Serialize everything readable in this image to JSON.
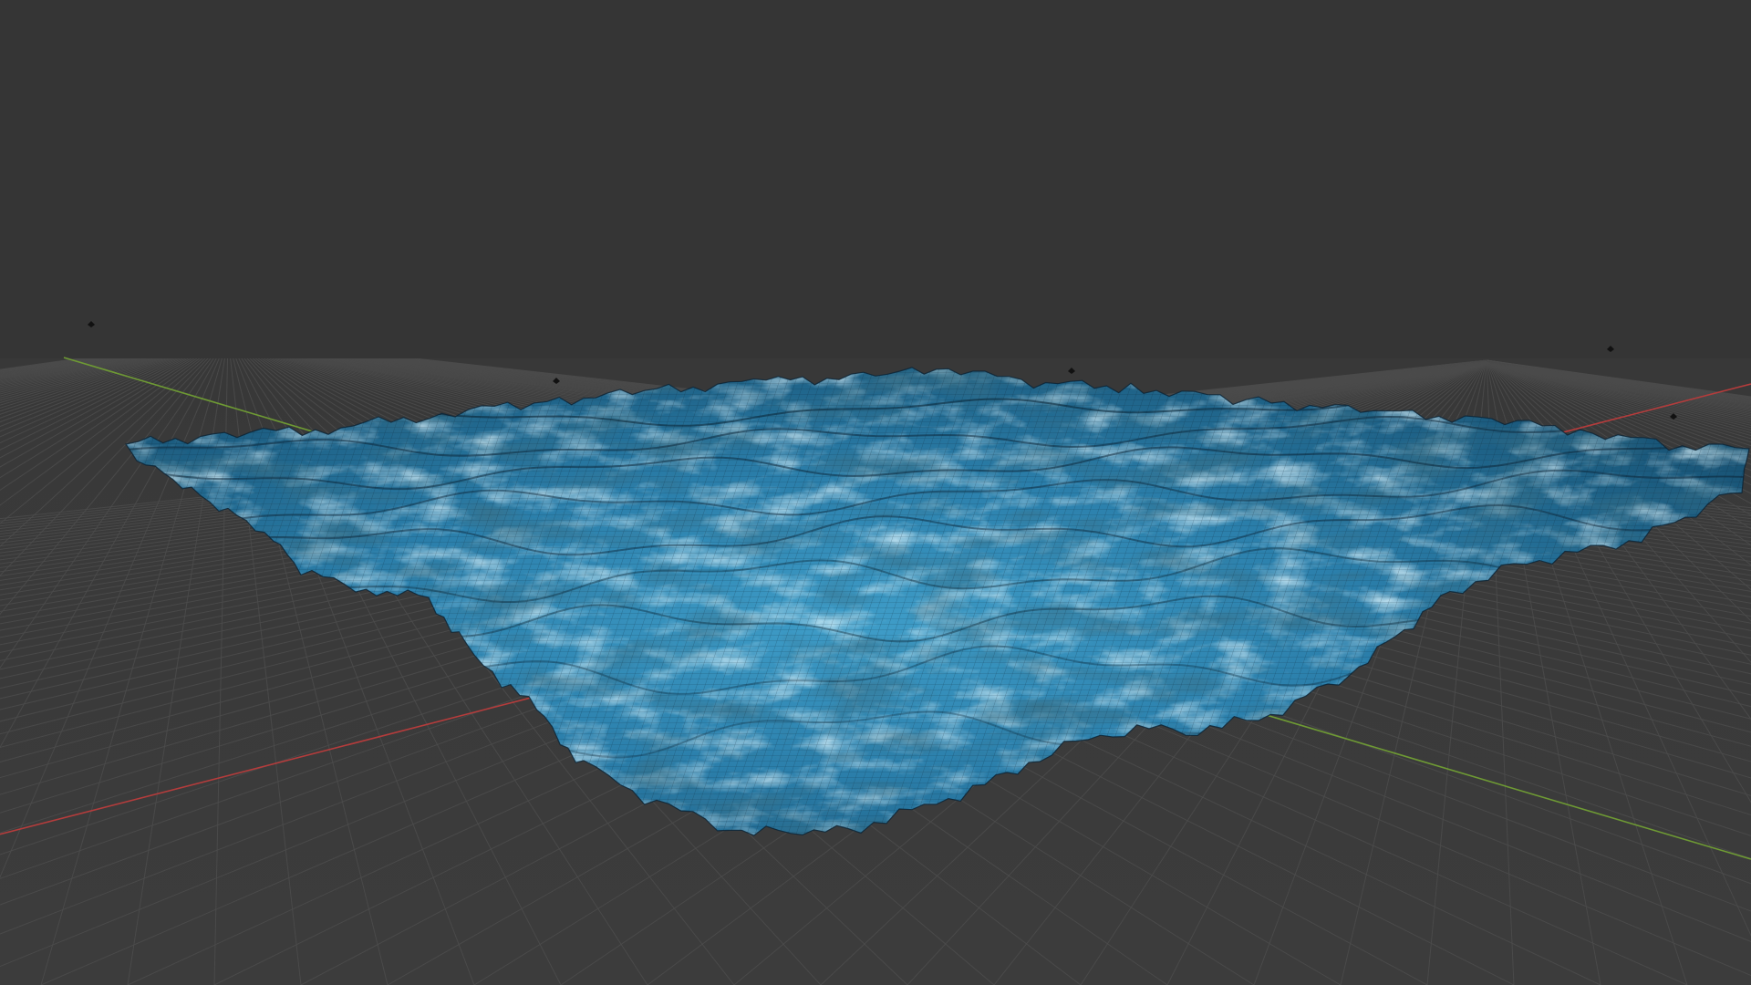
{
  "viewport": {
    "mode": "3d-perspective",
    "background_color": "#3a3a3a",
    "grid_color": "#4b4b4b",
    "x_axis_color": "#b43c3c",
    "y_axis_color": "#6e9a34"
  },
  "scene": {
    "object": "ocean-wave-mesh",
    "display": "textured-wireframe",
    "material_colors": [
      "#0e3d5a",
      "#1d6c93",
      "#3d9cc9",
      "#7cc8e6",
      "#c7e8f3"
    ],
    "wire_color": "#0a2233",
    "empties_count": 5
  }
}
